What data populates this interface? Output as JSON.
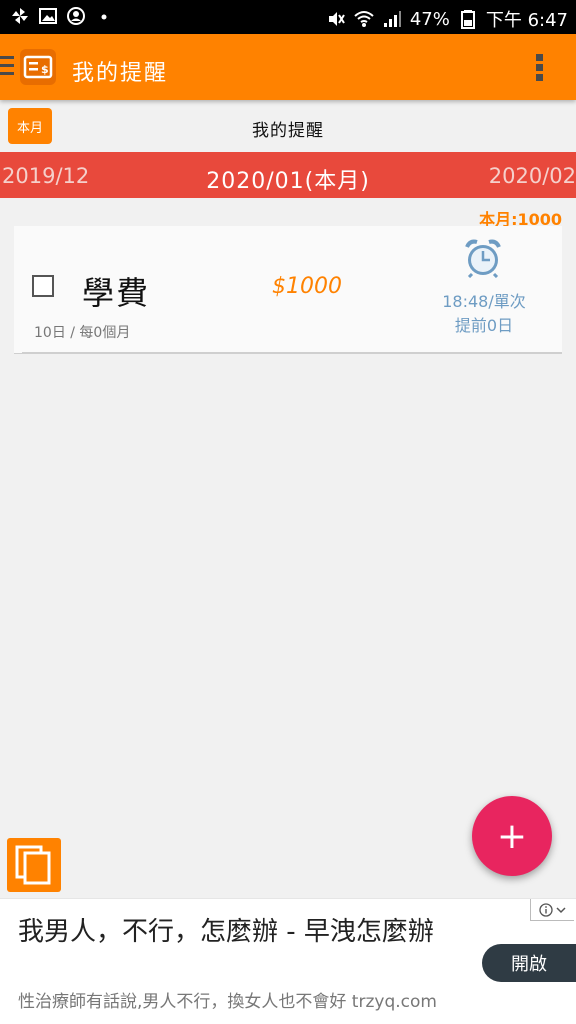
{
  "status_bar": {
    "battery": "47%",
    "time": "下午 6:47",
    "icons": [
      "pinwheel-icon",
      "image-icon",
      "account-icon",
      "dot-icon",
      "mute-icon",
      "wifi-icon",
      "signal-icon",
      "battery-icon"
    ]
  },
  "appbar": {
    "title": "我的提醒",
    "logo_icon": "bill-icon",
    "menu_icon": "hamburger-icon",
    "overflow_icon": "more-vert-icon",
    "color": "#ff8200"
  },
  "subheader": {
    "chip_label": "本月",
    "page_title": "我的提醒"
  },
  "month_nav": {
    "prev": "2019/12",
    "current": "2020/01(本月)",
    "next": "2020/02",
    "color": "#e8493c"
  },
  "summary": {
    "total": "本月:1000"
  },
  "reminders": [
    {
      "checked": false,
      "name": "學費",
      "amount": "$1000",
      "time_line1": "18:48/單次",
      "time_line2": "提前0日",
      "schedule": "10日 / 每0個月",
      "icon": "alarm-clock-icon"
    }
  ],
  "fab": {
    "label": "+",
    "color": "#e8255f"
  },
  "copy_button": {
    "icon": "copy-icon"
  },
  "ad": {
    "title": "我男人，不行，怎麼辦 - 早洩怎麼辦",
    "description": "性治療師有話說,男人不行，換女人也不會好 trzyq.com",
    "button": "開啟",
    "info_icon": "info-icon"
  }
}
